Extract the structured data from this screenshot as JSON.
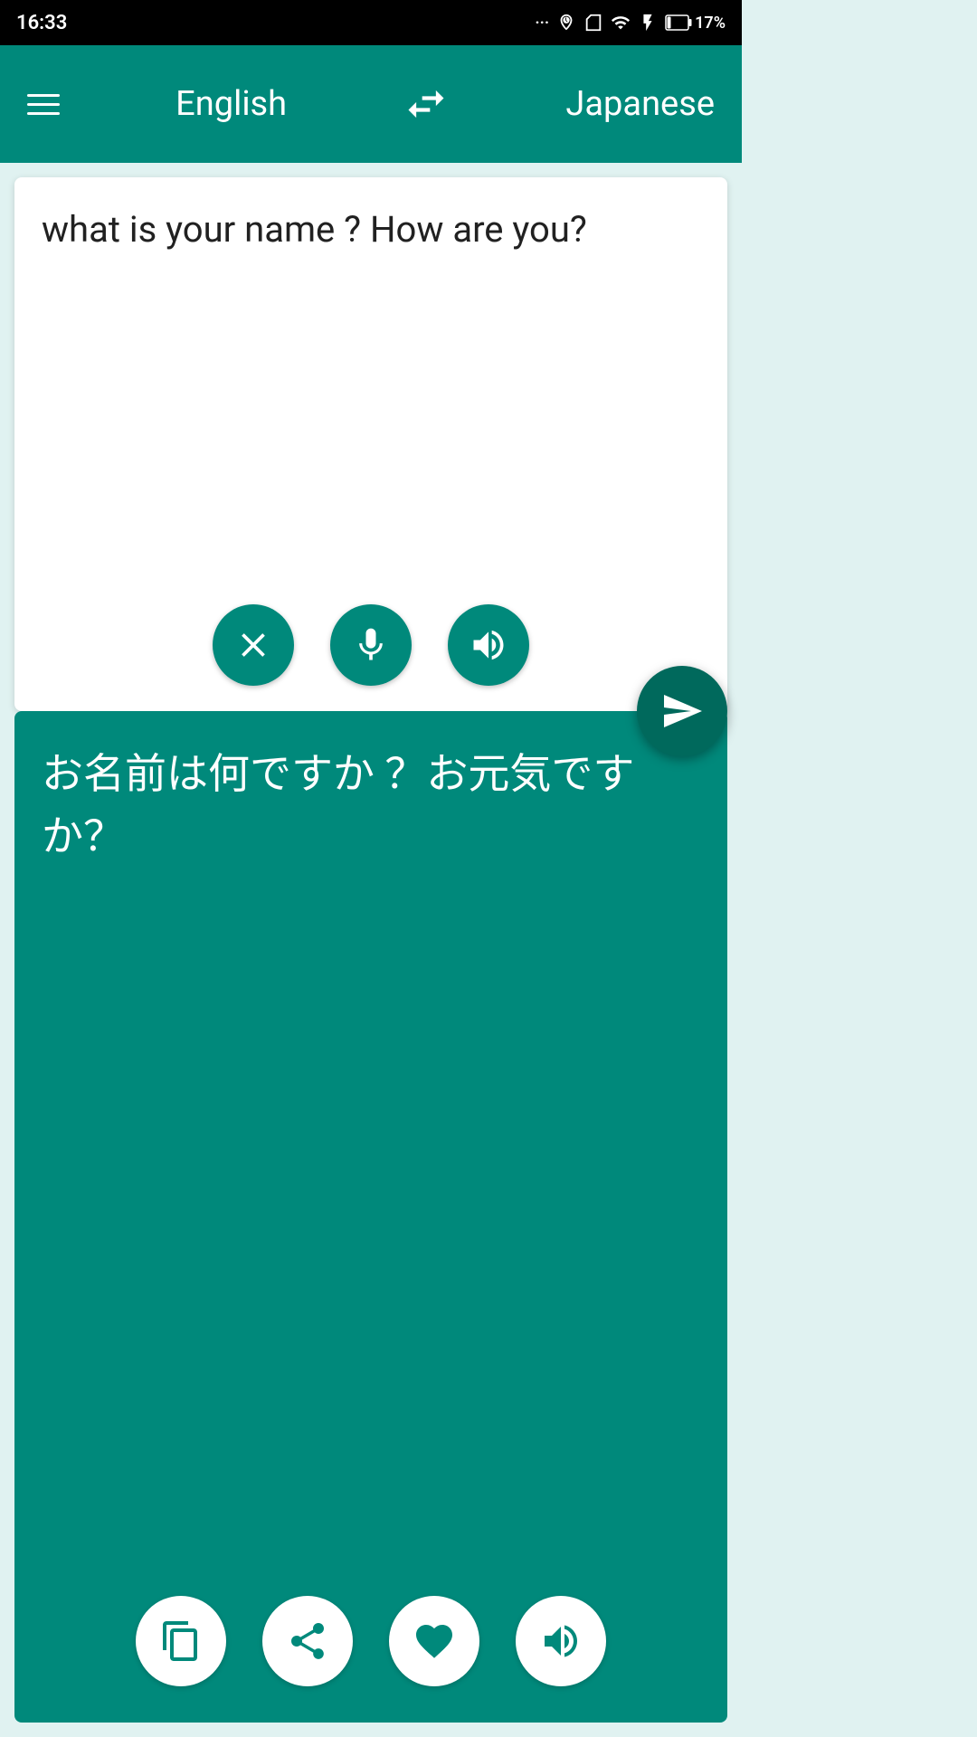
{
  "status": {
    "time": "16:33",
    "battery": "17%"
  },
  "toolbar": {
    "source_lang": "English",
    "target_lang": "Japanese",
    "menu_label": "Menu"
  },
  "source": {
    "text": "what is your name ? How are you?",
    "clear_label": "Clear",
    "mic_label": "Microphone",
    "speaker_label": "Speaker"
  },
  "target": {
    "text": "お名前は何ですか ？お元気ですか？",
    "copy_label": "Copy",
    "share_label": "Share",
    "favorite_label": "Favorite",
    "speaker_label": "Speaker"
  },
  "translate_label": "Translate",
  "colors": {
    "teal": "#00897b",
    "teal_dark": "#00695c",
    "white": "#ffffff"
  }
}
